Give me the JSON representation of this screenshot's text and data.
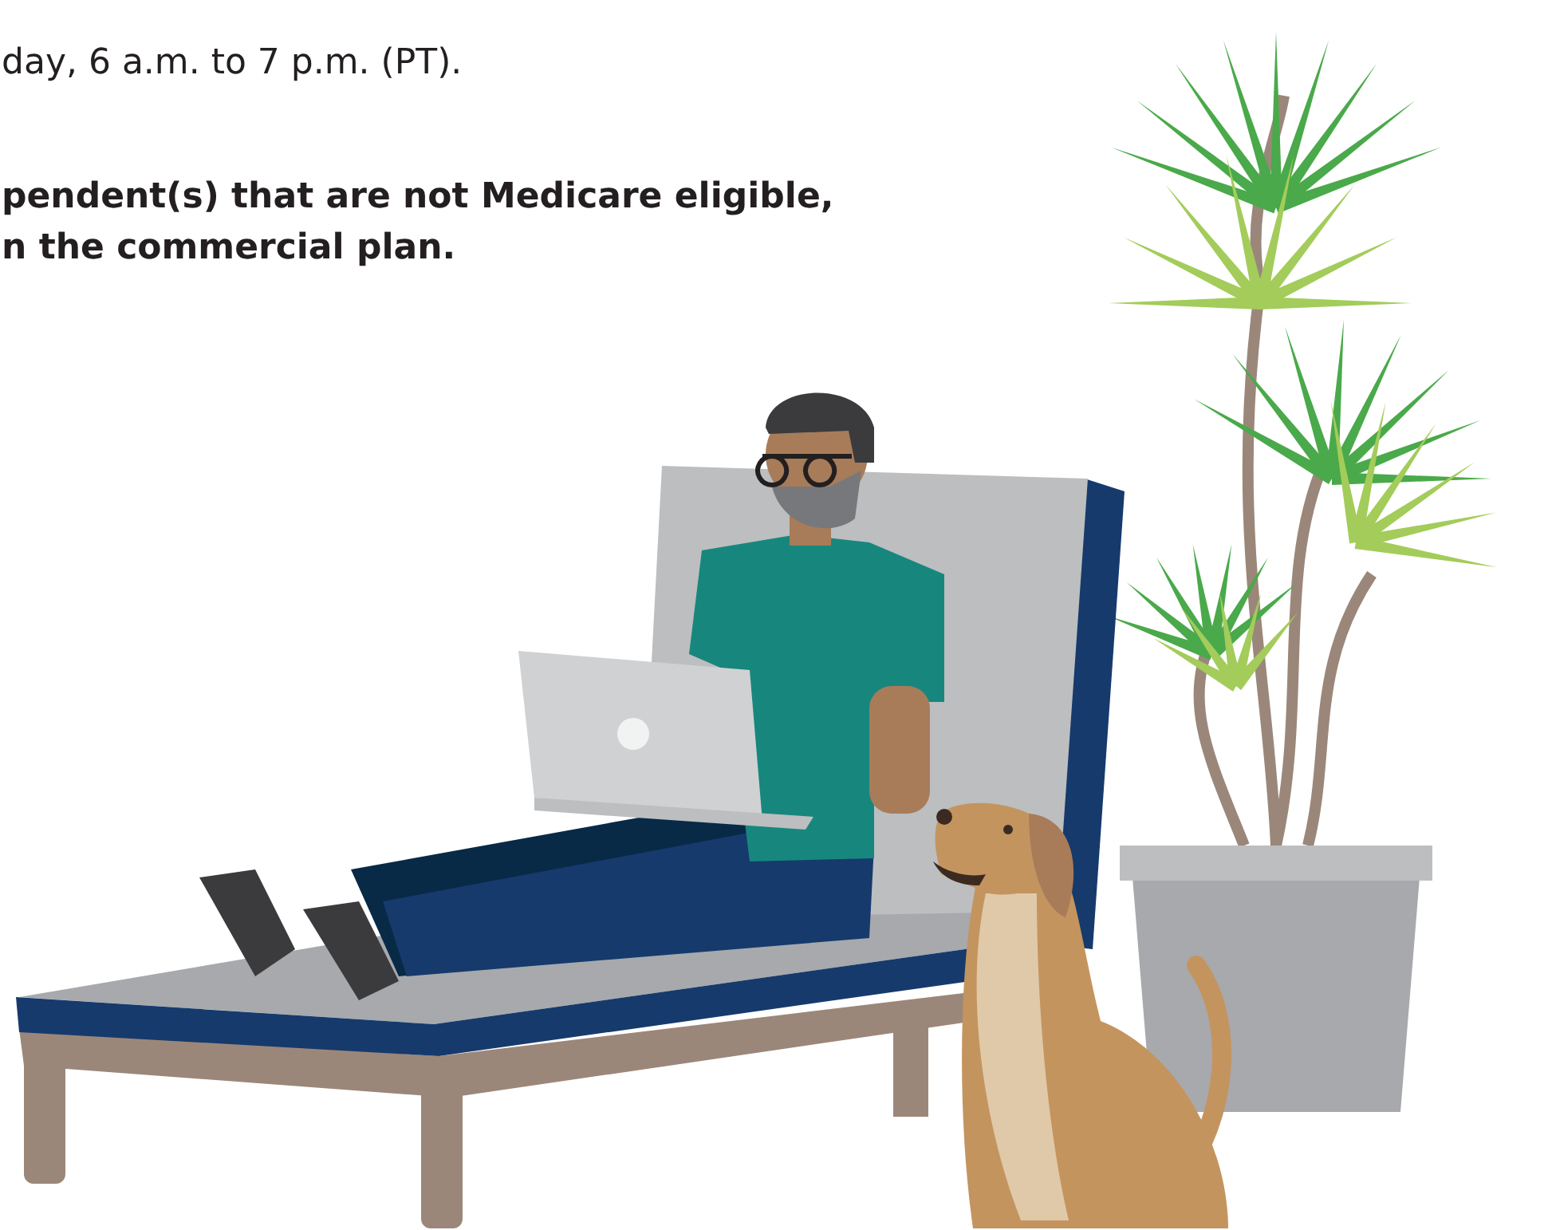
{
  "text": {
    "hours_line": "day, 6 a.m. to 7 p.m. (PT).",
    "note_lines": [
      "pendent(s) that are not Medicare eligible,",
      "n the commercial plan."
    ]
  }
}
